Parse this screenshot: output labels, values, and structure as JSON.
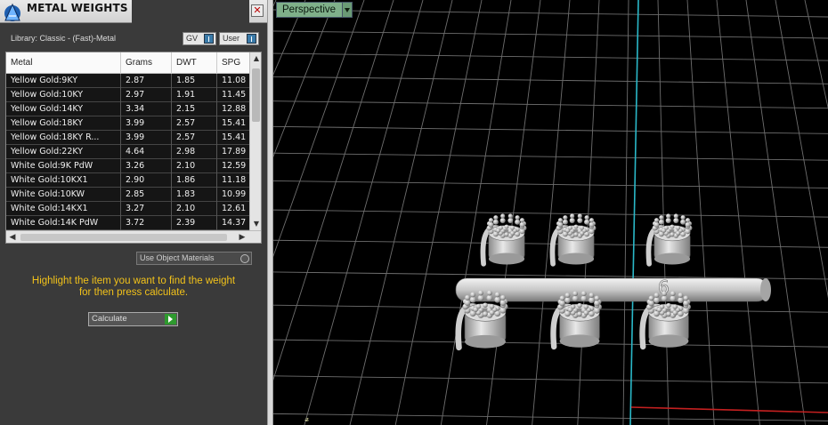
{
  "panel": {
    "title": "METAL WEIGHTS",
    "close_glyph": "✕",
    "library_label": "Library: Classic - (Fast)-Metal",
    "gv_label": "GV",
    "user_label": "User",
    "use_object_materials_label": "Use Object Materials",
    "hint_line1": "Highlight the item you want to find the weight",
    "hint_line2": "for then press calculate.",
    "calculate_label": "Calculate"
  },
  "table": {
    "headers": [
      "Metal",
      "Grams",
      "DWT",
      "SPG"
    ],
    "rows": [
      [
        "Yellow Gold:9KY",
        "2.87",
        "1.85",
        "11.08"
      ],
      [
        "Yellow Gold:10KY",
        "2.97",
        "1.91",
        "11.45"
      ],
      [
        "Yellow Gold:14KY",
        "3.34",
        "2.15",
        "12.88"
      ],
      [
        "Yellow Gold:18KY",
        "3.99",
        "2.57",
        "15.41"
      ],
      [
        "Yellow Gold:18KY R...",
        "3.99",
        "2.57",
        "15.41"
      ],
      [
        "Yellow Gold:22KY",
        "4.64",
        "2.98",
        "17.89"
      ],
      [
        "White Gold:9K PdW",
        "3.26",
        "2.10",
        "12.59"
      ],
      [
        "White Gold:10KX1",
        "2.90",
        "1.86",
        "11.18"
      ],
      [
        "White Gold:10KW",
        "2.85",
        "1.83",
        "10.99"
      ],
      [
        "White Gold:14KX1",
        "3.27",
        "2.10",
        "12.61"
      ],
      [
        "White Gold:14K PdW",
        "3.72",
        "2.39",
        "14.37"
      ]
    ]
  },
  "viewport": {
    "view_mode": "Perspective",
    "grid_color": "#6e6e6e",
    "axis_x_color": "#c42020",
    "axis_y_color": "#2ab8c8"
  },
  "icons": {
    "logo": "app-logo-icon",
    "close": "close-icon",
    "dropdown": "chevron-down-icon",
    "go": "play-arrow-icon"
  }
}
